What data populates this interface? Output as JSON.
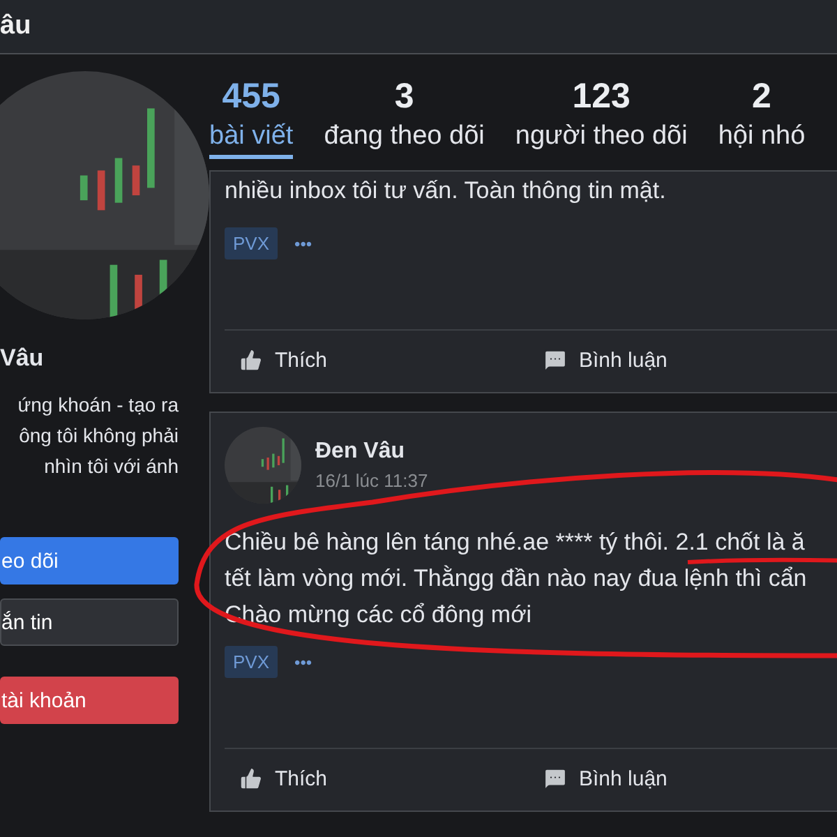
{
  "header": {
    "title": "âu"
  },
  "profile": {
    "avatar": {
      "kind": "picture"
    },
    "name": "Vâu",
    "bio_lines": [
      "ứng khoán - tạo ra",
      "ông tôi không phải",
      "nhìn tôi với ánh"
    ],
    "buttons": [
      {
        "label": "eo dõi",
        "kind": "primary"
      },
      {
        "label": "ắn tin",
        "kind": "secondary"
      },
      {
        "label": "tài khoản",
        "kind": "danger"
      }
    ]
  },
  "stats": [
    {
      "value": "455",
      "label": "bài viết",
      "selected": true
    },
    {
      "value": "3",
      "label": "đang theo dõi",
      "selected": false
    },
    {
      "value": "123",
      "label": "người theo dõi",
      "selected": false
    },
    {
      "value": "2",
      "label": "hội nhó",
      "selected": false
    }
  ],
  "posts": [
    {
      "lines": [
        "nhiều inbox tôi tư vấn. Toàn thông tin mật."
      ],
      "tag": "PVX",
      "more": "•••",
      "actions": [
        {
          "label": "Thích",
          "kind": "like"
        },
        {
          "label": "Bình luận",
          "kind": "comment"
        }
      ]
    },
    {
      "author": "Đen Vâu",
      "time": "16/1 lúc 11:37",
      "avatar": {
        "kind": "picture"
      },
      "lines": [
        "Chiều bê hàng lên táng nhé.ae **** tý thôi. 2.1 chốt là ă",
        "tết làm vòng mới. Thằngg đần nào nay đua lệnh thì cẩn",
        "Chào mừng các cổ đông mới"
      ],
      "tag": "PVX",
      "more": "•••",
      "actions": [
        {
          "label": "Thích",
          "kind": "like"
        },
        {
          "label": "Bình luận",
          "kind": "comment"
        }
      ],
      "highlighted": true
    }
  ]
}
